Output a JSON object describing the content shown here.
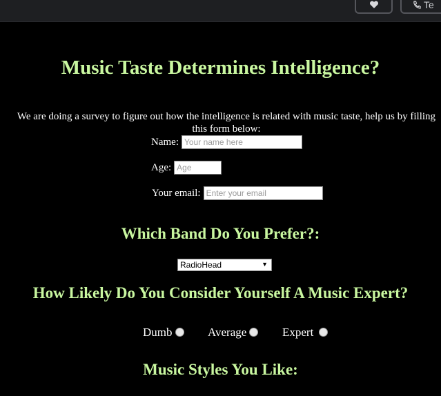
{
  "header": {
    "title": "Music Taste Determines Intelligence?",
    "intro": "We are doing a survey to figure out how the intelligence is related with music taste, help us by filling this form below:"
  },
  "topbar": {
    "button_two_label": "Te",
    "icons": [
      "heart-icon",
      "phone-icon"
    ]
  },
  "form": {
    "name": {
      "label": "Name:",
      "placeholder": "Your name here"
    },
    "age": {
      "label": "Age:",
      "placeholder": "Age"
    },
    "email": {
      "label": "Your email:",
      "placeholder": "Enter your email"
    }
  },
  "band": {
    "heading": "Which Band Do You Prefer?:",
    "selected": "RadioHead"
  },
  "expertise": {
    "heading": "How Likely Do You Consider Yourself A Music Expert?",
    "options": [
      "Dumb",
      "Average",
      "Expert"
    ]
  },
  "styles": {
    "heading": "Music Styles You Like:"
  }
}
